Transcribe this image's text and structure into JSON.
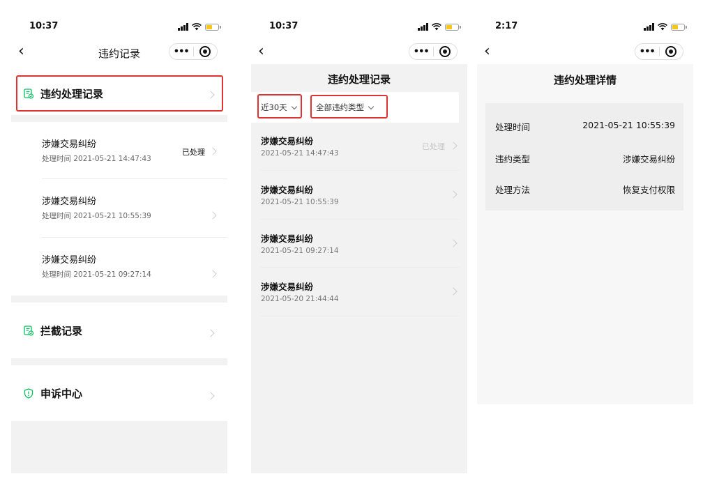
{
  "screens": [
    {
      "time": "10:37",
      "nav_title": "违约记录",
      "menu_items": [
        {
          "label": "违约处理记录",
          "icon": "document-check-icon"
        },
        {
          "label": "拦截记录",
          "icon": "document-check-icon"
        },
        {
          "label": "申诉中心",
          "icon": "shield-icon"
        }
      ],
      "sub_items": [
        {
          "title": "涉嫌交易纠纷",
          "time": "处理时间 2021-05-21 14:47:43",
          "status": "已处理"
        },
        {
          "title": "涉嫌交易纠纷",
          "time": "处理时间 2021-05-21 10:55:39",
          "status": ""
        },
        {
          "title": "涉嫌交易纠纷",
          "time": "处理时间 2021-05-21 09:27:14",
          "status": ""
        }
      ]
    },
    {
      "time": "10:37",
      "page_title": "违约处理记录",
      "filters": {
        "period": "近30天",
        "type": "全部违约类型"
      },
      "records": [
        {
          "title": "涉嫌交易纠纷",
          "time": "2021-05-21 14:47:43",
          "status": "已处理"
        },
        {
          "title": "涉嫌交易纠纷",
          "time": "2021-05-21 10:55:39",
          "status": ""
        },
        {
          "title": "涉嫌交易纠纷",
          "time": "2021-05-21 09:27:14",
          "status": ""
        },
        {
          "title": "涉嫌交易纠纷",
          "time": "2021-05-20 21:44:44",
          "status": ""
        }
      ]
    },
    {
      "time": "2:17",
      "page_title": "违约处理详情",
      "details": [
        {
          "key": "处理时间",
          "value": "2021-05-21 10:55:39"
        },
        {
          "key": "违约类型",
          "value": "涉嫌交易纠纷"
        },
        {
          "key": "处理方法",
          "value": "恢复支付权限"
        }
      ]
    }
  ],
  "colors": {
    "accent_green": "#07c160",
    "highlight_red": "#e0322e"
  }
}
